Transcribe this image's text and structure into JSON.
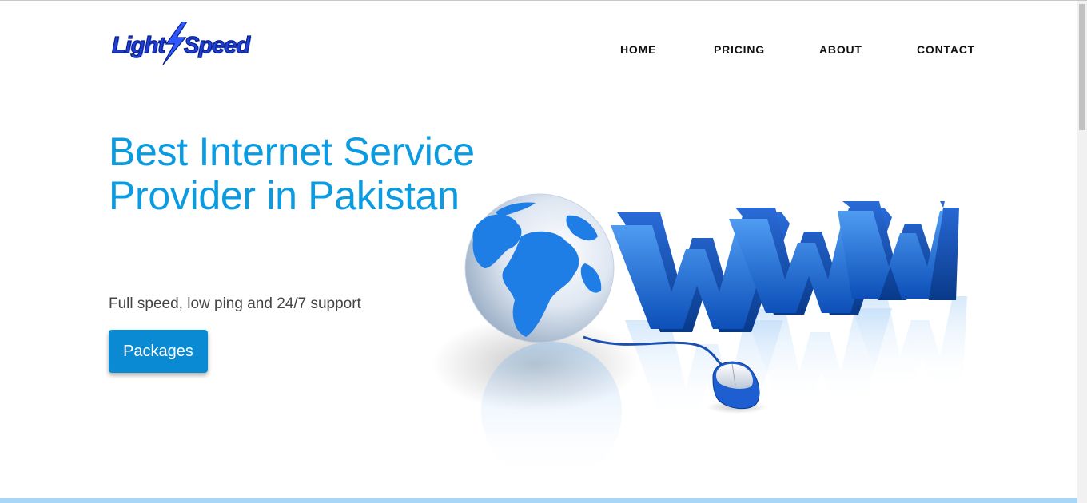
{
  "header": {
    "logo": {
      "text_light": "Light",
      "text_speed": "Speed",
      "icon": "lightning-bolt-icon"
    },
    "nav": {
      "home": "HOME",
      "pricing": "PRICING",
      "about": "ABOUT",
      "contact": "CONTACT"
    }
  },
  "hero": {
    "title": "Best Internet Service Provider in Pakistan",
    "subtitle": "Full speed, low ping and 24/7 support",
    "cta_label": "Packages",
    "illustration": {
      "letters": [
        "W",
        "W",
        "W"
      ],
      "icons": [
        "globe-icon",
        "mouse-icon"
      ]
    }
  },
  "colors": {
    "accent": "#0b9be0",
    "button": "#0a8ad3",
    "logo_blue": "#1d3fd8",
    "strip": "#a8d6f6"
  }
}
